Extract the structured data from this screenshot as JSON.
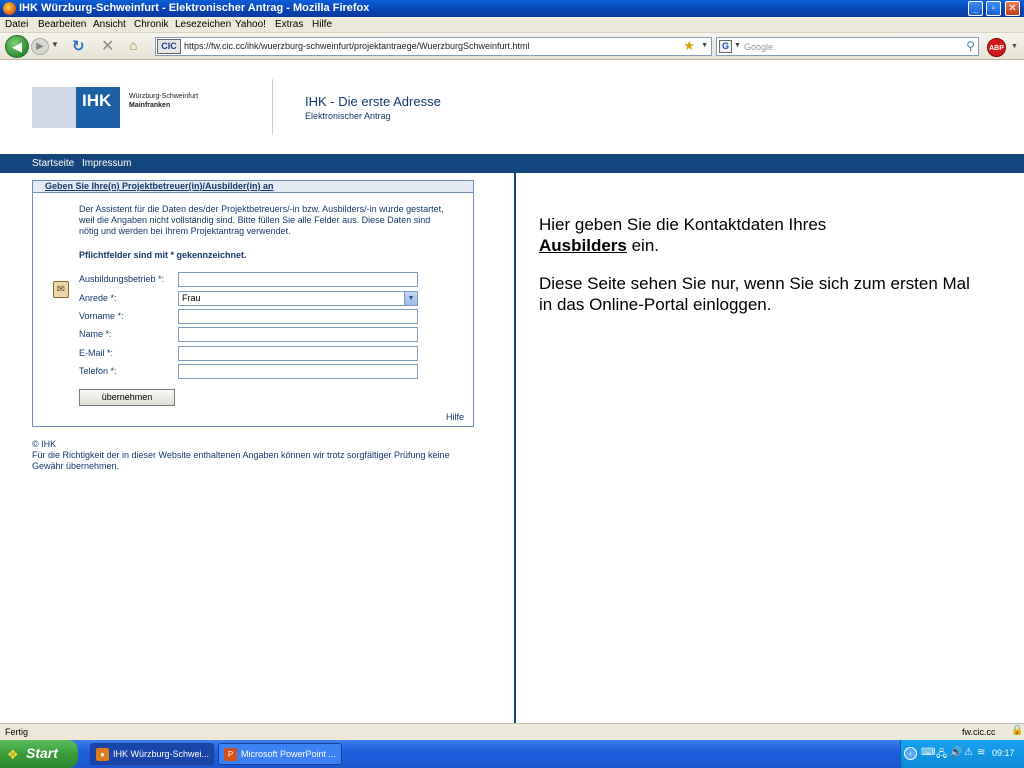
{
  "window": {
    "title": "IHK Würzburg-Schweinfurt - Elektronischer Antrag - Mozilla Firefox",
    "minimize": "_",
    "maximize": "▫",
    "close": "✕"
  },
  "menu": {
    "items": [
      "Datei",
      "Bearbeiten",
      "Ansicht",
      "Chronik",
      "Lesezeichen",
      "Yahoo!",
      "Extras",
      "Hilfe"
    ]
  },
  "navbar": {
    "url": "https://fw.cic.cc/ihk/wuerzburg-schweinfurt/projektantraege/WuerzburgSchweinfurt.html",
    "url_badge": "CIC",
    "search_placeholder": "Google",
    "search_engine_letter": "G",
    "abp_label": "ABP"
  },
  "page": {
    "logo": {
      "text": "IHK",
      "sub1": "Würzburg-Schweinfurt",
      "sub2": "Mainfranken"
    },
    "heading": "IHK - Die erste Adresse",
    "subheading": "Elektronischer Antrag",
    "nav": [
      "Startseite",
      "Impressum"
    ],
    "form": {
      "title": "Geben Sie Ihre(n) Projektbetreuer(in)/Ausbilder(in) an",
      "intro": "Der Assistent für die Daten des/der Projektbetreuers/-in bzw. Ausbilders/-in wurde gestartet, weil die Angaben nicht vollständig sind. Bitte füllen Sie alle Felder aus. Diese Daten sind nötig und werden bei Ihrem Projektantrag verwendet.",
      "required_note": "Pflichtfelder sind mit * gekennzeichnet.",
      "fields": [
        {
          "label": "Ausbildungsbetrieb *:",
          "value": ""
        },
        {
          "label": "Anrede *:",
          "value": "Frau"
        },
        {
          "label": "Vorname *:",
          "value": ""
        },
        {
          "label": "Name *:",
          "value": ""
        },
        {
          "label": "E-Mail *:",
          "value": ""
        },
        {
          "label": "Telefon *:",
          "value": ""
        }
      ],
      "submit": "übernehmen",
      "help": "Hilfe"
    },
    "copyright": "© IHK",
    "disclaimer": "Für die Richtigkeit der in dieser Website enthaltenen Angaben können wir trotz sorgfältiger Prüfung keine Gewähr übernehmen."
  },
  "info": {
    "line1_pre": "Hier geben Sie die Kontaktdaten Ihres",
    "line1_bold": "Ausbilders",
    "line1_post": " ein.",
    "line2": "Diese Seite sehen Sie nur, wenn Sie sich zum ersten Mal in das Online-Portal einloggen."
  },
  "status": {
    "text": "Fertig",
    "host": "fw.cic.cc"
  },
  "taskbar": {
    "start": "Start",
    "tasks": [
      {
        "label": "IHK Würzburg-Schwei...",
        "active": true
      },
      {
        "label": "Microsoft PowerPoint ...",
        "active": false
      }
    ],
    "clock": "09:17"
  }
}
